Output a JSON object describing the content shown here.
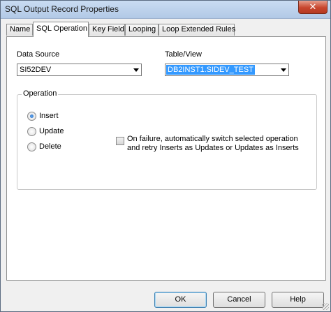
{
  "window": {
    "title": "SQL Output Record Properties",
    "close_glyph": "✕"
  },
  "tabs": [
    {
      "label": "Name",
      "active": false
    },
    {
      "label": "SQL Operation",
      "active": true
    },
    {
      "label": "Key Field",
      "active": false
    },
    {
      "label": "Looping",
      "active": false
    },
    {
      "label": "Loop Extended Rules",
      "active": false
    }
  ],
  "data_source": {
    "label": "Data Source",
    "value": "SI52DEV"
  },
  "table_view": {
    "label": "Table/View",
    "value": "DB2INST1.SIDEV_TEST"
  },
  "operation": {
    "title": "Operation",
    "options": [
      {
        "label": "Insert",
        "checked": true
      },
      {
        "label": "Update",
        "checked": false
      },
      {
        "label": "Delete",
        "checked": false
      }
    ],
    "failover_checkbox": {
      "label": "On failure, automatically switch selected operation and retry Inserts as Updates or Updates as Inserts",
      "checked": false
    }
  },
  "buttons": {
    "ok": "OK",
    "cancel": "Cancel",
    "help": "Help"
  },
  "colors": {
    "selection": "#3399ff",
    "radio_dot": "#1b5fb8",
    "close_button": "#c8462e"
  }
}
